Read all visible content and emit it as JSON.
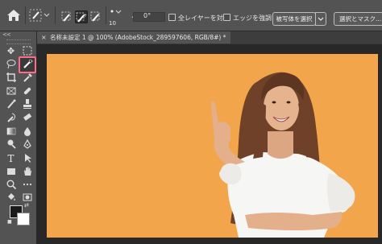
{
  "options_bar": {
    "brush_size": "10",
    "angle": "0°",
    "sample_all_layers_label": "全レイヤーを対象",
    "enhance_edge_label": "エッジを強調",
    "select_subject_label": "被写体を選択",
    "select_and_mask_label": "選択とマスク..."
  },
  "toolbar": {
    "collapse": "<<"
  },
  "document": {
    "tab_close": "×",
    "tab_title": "名称未設定 1 @ 100% (AdobeStock_289597606, RGB/8#) *"
  },
  "colors": {
    "photo_background": "#f2a54a",
    "highlight": "#ff6b8a",
    "skin": "#e3b08b",
    "hair": "#6e4128",
    "shirt": "#f6f6f4"
  }
}
